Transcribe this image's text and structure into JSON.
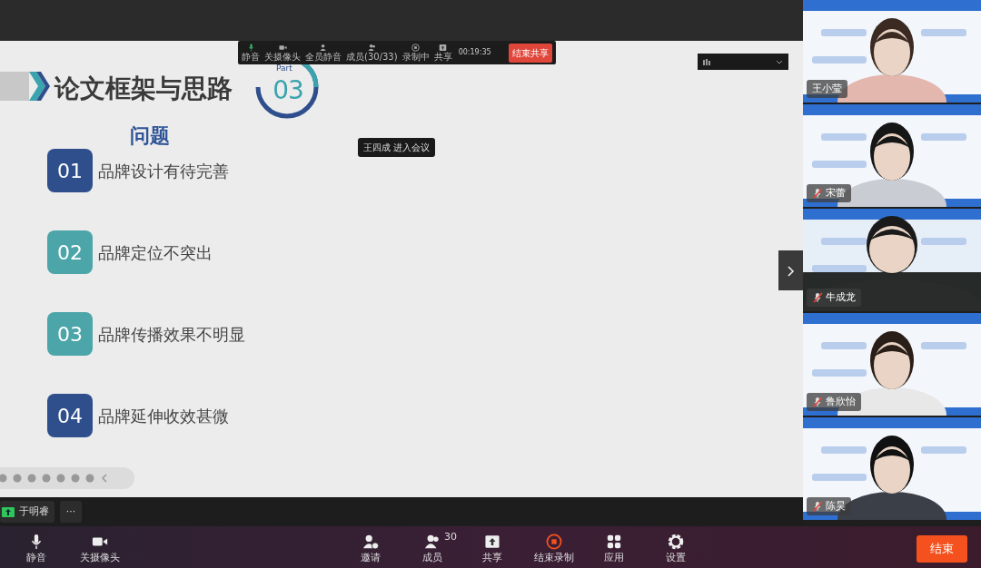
{
  "share_toolbar": {
    "buttons": [
      {
        "kind": "mic",
        "label": "静音"
      },
      {
        "kind": "camera",
        "label": "关摄像头"
      },
      {
        "kind": "mute-all",
        "label": "全员静音"
      },
      {
        "kind": "members",
        "label": "成员(30/33)"
      },
      {
        "kind": "record",
        "label": "录制中"
      },
      {
        "kind": "share",
        "label": "共享"
      }
    ],
    "timer": "00:19:35",
    "stop_button": "结束共享"
  },
  "notification": "王四成 进入会议",
  "slide": {
    "title": "论文框架与思路",
    "part_label": "Part",
    "part_number": "03",
    "subtitle": "问题",
    "items": [
      {
        "number": "01",
        "text": "品牌设计有待完善",
        "color": "#2e4f8c"
      },
      {
        "number": "02",
        "text": "品牌定位不突出",
        "color": "#4ba5a9"
      },
      {
        "number": "03",
        "text": "品牌传播效果不明显",
        "color": "#4ba5a9"
      },
      {
        "number": "04",
        "text": "品牌延伸收效甚微",
        "color": "#2e4f8c"
      }
    ]
  },
  "sharer": {
    "name": "于明睿",
    "more": "···"
  },
  "participants": [
    {
      "name": "王小莹",
      "muted": false
    },
    {
      "name": "宋蕾",
      "muted": true
    },
    {
      "name": "牛成龙",
      "muted": true
    },
    {
      "name": "鲁欣怡",
      "muted": true
    },
    {
      "name": "陈昊",
      "muted": true
    }
  ],
  "bottom_toolbar": {
    "left": [
      {
        "kind": "mic",
        "label": "静音"
      },
      {
        "kind": "camera",
        "label": "关摄像头"
      }
    ],
    "center": [
      {
        "kind": "invite",
        "label": "邀请"
      },
      {
        "kind": "members",
        "label": "成员",
        "count": "30"
      },
      {
        "kind": "share",
        "label": "共享"
      },
      {
        "kind": "record",
        "label": "结束录制"
      },
      {
        "kind": "apps",
        "label": "应用"
      },
      {
        "kind": "settings",
        "label": "设置"
      }
    ],
    "end_button": "结束"
  }
}
